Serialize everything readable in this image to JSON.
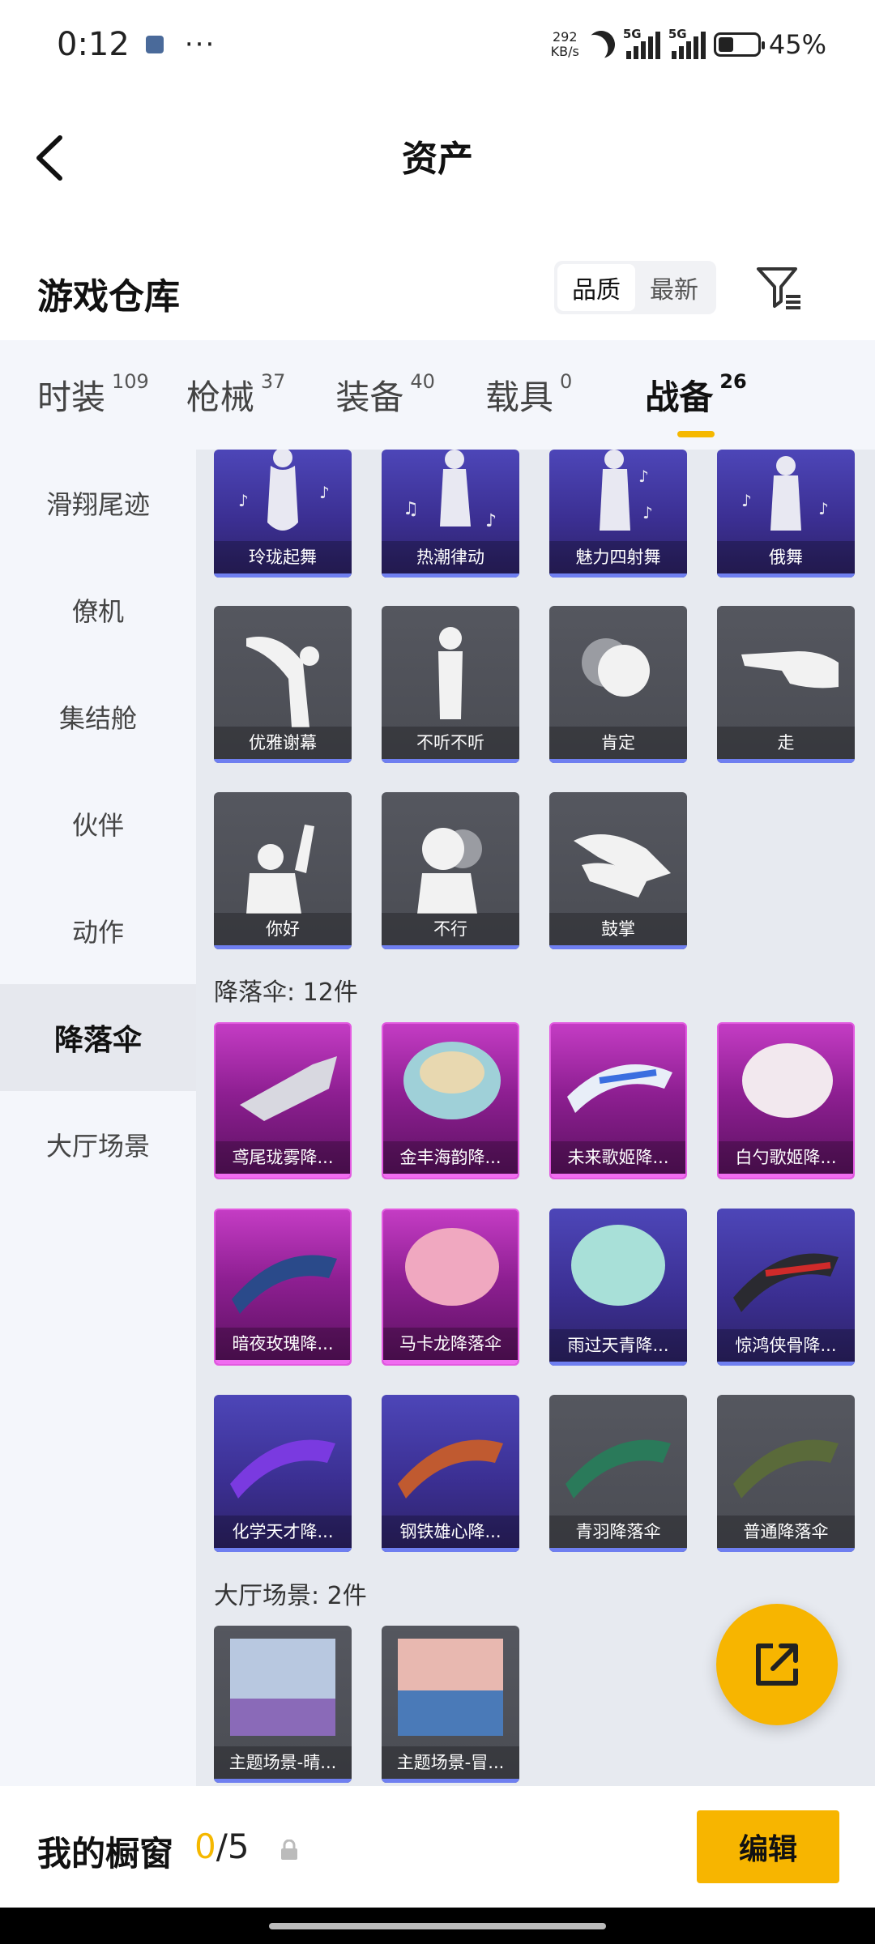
{
  "status_bar": {
    "time": "0:12",
    "dots": "···",
    "net_speed_value": "292",
    "net_speed_unit": "KB/s",
    "sim1": "5G",
    "sim2": "5G",
    "battery_text": "45%"
  },
  "header": {
    "title": "资产"
  },
  "warehouse": {
    "title": "游戏仓库",
    "sort_quality": "品质",
    "sort_newest": "最新"
  },
  "tabs": [
    {
      "label": "时装",
      "count": "109"
    },
    {
      "label": "枪械",
      "count": "37"
    },
    {
      "label": "装备",
      "count": "40"
    },
    {
      "label": "载具",
      "count": "0"
    },
    {
      "label": "战备",
      "count": "26"
    }
  ],
  "sidebar": {
    "items": [
      "滑翔尾迹",
      "僚机",
      "集结舱",
      "伙伴",
      "动作",
      "降落伞",
      "大厅场景"
    ]
  },
  "emotes": {
    "row1": [
      "玲珑起舞",
      "热潮律动",
      "魅力四射舞",
      "俄舞"
    ],
    "row2": [
      "优雅谢幕",
      "不听不听",
      "肯定",
      "走"
    ],
    "row3": [
      "你好",
      "不行",
      "鼓掌"
    ]
  },
  "parachutes": {
    "section_title": "降落伞: 12件",
    "row1": [
      "鸢尾珑雾降...",
      "金丰海韵降...",
      "未来歌姬降...",
      "白勺歌姬降..."
    ],
    "row2": [
      "暗夜玫瑰降...",
      "马卡龙降落伞",
      "雨过天青降...",
      "惊鸿侠骨降..."
    ],
    "row3": [
      "化学天才降...",
      "钢铁雄心降...",
      "青羽降落伞",
      "普通降落伞"
    ]
  },
  "lobby": {
    "section_title": "大厅场景: 2件",
    "items": [
      "主题场景-晴...",
      "主题场景-冒..."
    ]
  },
  "bottom": {
    "window_label": "我的橱窗",
    "window_current": "0",
    "window_total": "/5",
    "edit_label": "编辑"
  },
  "colors": {
    "accent": "#f5b800",
    "rare_purple": "#3b2f92",
    "epic_magenta": "#8e1f92",
    "common_gray": "#4a4c53"
  }
}
